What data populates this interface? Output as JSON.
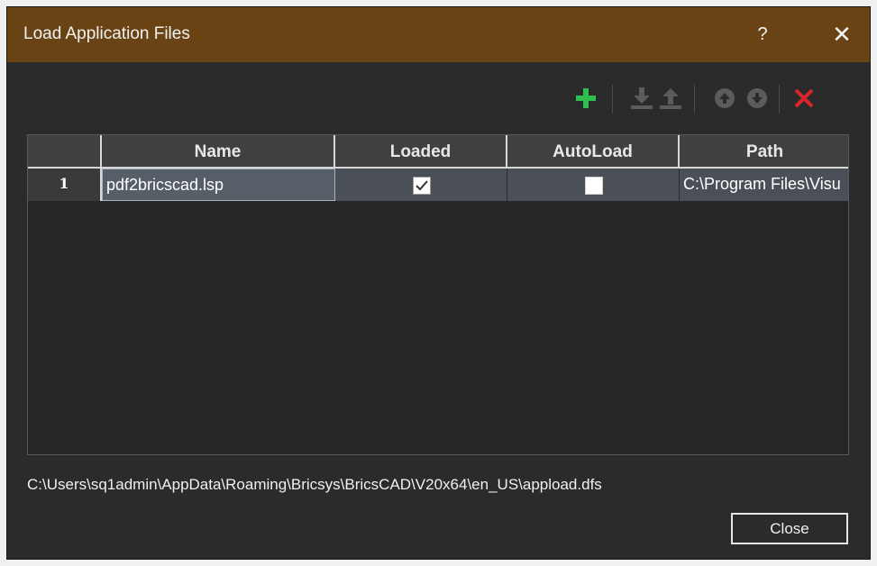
{
  "window": {
    "title": "Load Application Files",
    "help_label": "?",
    "close_glyph": "✕"
  },
  "toolbar": {
    "buttons": [
      {
        "name": "add-icon",
        "color": "#2fbf4f"
      },
      {
        "name": "download-icon",
        "color": "#5c5c5c"
      },
      {
        "name": "upload-icon",
        "color": "#5c5c5c"
      },
      {
        "name": "move-up-icon",
        "color": "#5c5c5c"
      },
      {
        "name": "move-down-icon",
        "color": "#5c5c5c"
      },
      {
        "name": "remove-icon",
        "color": "#d9262b"
      }
    ]
  },
  "table": {
    "columns": [
      "Name",
      "Loaded",
      "AutoLoad",
      "Path"
    ],
    "rows": [
      {
        "num": "1",
        "name": "pdf2bricscad.lsp",
        "loaded": true,
        "autoload": false,
        "path": "C:\\Program Files\\Visu"
      }
    ]
  },
  "status": {
    "path": "C:\\Users\\sq1admin\\AppData\\Roaming\\Bricsys\\BricsCAD\\V20x64\\en_US\\appload.dfs"
  },
  "footer": {
    "close_label": "Close"
  }
}
